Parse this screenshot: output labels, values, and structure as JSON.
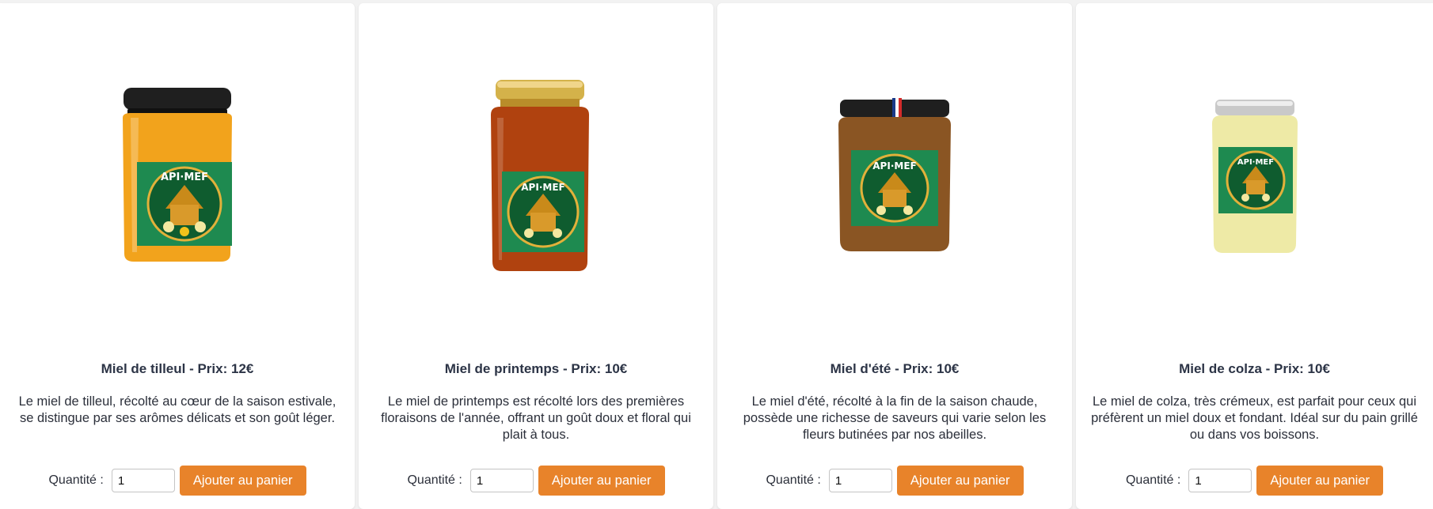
{
  "products": [
    {
      "title": "Miel de tilleul - Prix: 12€",
      "description": "Le miel de tilleul, récolté au cœur de la saison estivale, se distingue par ses arômes délicats et son goût léger.",
      "quantity_label": "Quantité :",
      "quantity_value": "1",
      "button_label": "Ajouter au panier",
      "label_text": "API MEF",
      "honey_color": "#f2a31c",
      "lid_color": "#1f1f1f"
    },
    {
      "title": "Miel de printemps - Prix: 10€",
      "description": "Le miel de printemps est récolté lors des premières floraisons de l'année, offrant un goût doux et floral qui plait à tous.",
      "quantity_label": "Quantité :",
      "quantity_value": "1",
      "button_label": "Ajouter au panier",
      "label_text": "API MEF",
      "honey_color": "#b0420f",
      "lid_color": "#d4b24a"
    },
    {
      "title": "Miel d'été - Prix: 10€",
      "description": "Le miel d'été, récolté à la fin de la saison chaude, possède une richesse de saveurs qui varie selon les fleurs butinées par nos abeilles.",
      "quantity_label": "Quantité :",
      "quantity_value": "1",
      "button_label": "Ajouter au panier",
      "label_text": "API MEF",
      "honey_color": "#8a5523",
      "lid_color": "#1f1f1f"
    },
    {
      "title": "Miel de colza - Prix: 10€",
      "description": "Le miel de colza, très crémeux, est parfait pour ceux qui préfèrent un miel doux et fondant. Idéal sur du pain grillé ou dans vos boissons.",
      "quantity_label": "Quantité :",
      "quantity_value": "1",
      "button_label": "Ajouter au panier",
      "label_text": "API MEF",
      "honey_color": "#eeeaa6",
      "lid_color": "#c9c9c9"
    }
  ],
  "colors": {
    "accent_button": "#e8832a",
    "label_green": "#1e8a50"
  }
}
